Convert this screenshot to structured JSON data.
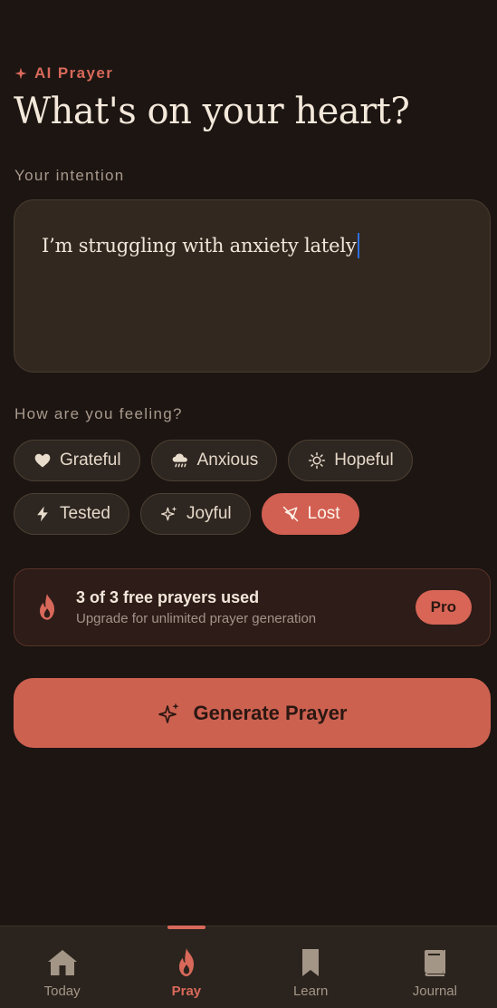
{
  "header": {
    "eyebrow": "AI Prayer",
    "title": "What's on your heart?"
  },
  "intention": {
    "label": "Your intention",
    "value": "I’m struggling with anxiety lately"
  },
  "feelings": {
    "label": "How are you feeling?",
    "options": [
      {
        "label": "Grateful",
        "icon": "heart-icon"
      },
      {
        "label": "Anxious",
        "icon": "rain-cloud-icon"
      },
      {
        "label": "Hopeful",
        "icon": "sun-icon"
      },
      {
        "label": "Tested",
        "icon": "lightning-icon"
      },
      {
        "label": "Joyful",
        "icon": "sparkle-icon"
      },
      {
        "label": "Lost",
        "icon": "compass-off-icon",
        "selected": true
      }
    ]
  },
  "limit": {
    "title": "3 of 3 free prayers used",
    "subtitle": "Upgrade for unlimited prayer generation",
    "badge": "Pro"
  },
  "generate": {
    "label": "Generate Prayer"
  },
  "tabs": [
    {
      "label": "Today",
      "icon": "home-icon"
    },
    {
      "label": "Pray",
      "icon": "flame-icon",
      "active": true
    },
    {
      "label": "Learn",
      "icon": "bookmark-icon"
    },
    {
      "label": "Journal",
      "icon": "book-icon"
    }
  ],
  "colors": {
    "background": "#1c1512",
    "accent": "#d8695a",
    "card": "#33281f"
  }
}
